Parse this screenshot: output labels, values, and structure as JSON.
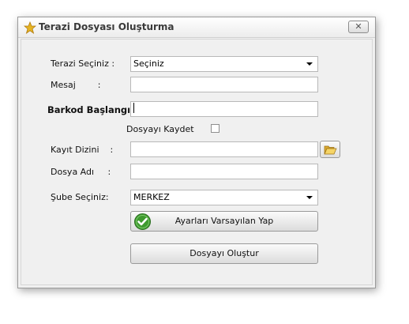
{
  "window": {
    "title": "Terazi Dosyası Oluşturma",
    "close_glyph": "✕"
  },
  "form": {
    "scale_label": "Terazi Seçiniz :",
    "scale_value": "Seçiniz",
    "message_label": "Mesaj        :",
    "message_value": "",
    "barcode_label": "Barkod Başlangıç :",
    "barcode_value": "",
    "save_file_label": "Dosyayı Kaydet",
    "save_file_checked": false,
    "folder_label": "Kayıt Dizini    :",
    "folder_value": "",
    "filename_label": "Dosya Adı     :",
    "filename_value": "",
    "branch_label": "Şube Seçiniz:",
    "branch_value": "MERKEZ"
  },
  "buttons": {
    "defaults_label": "Ayarları Varsayılan Yap",
    "create_label": "Dosyayı Oluştur"
  },
  "colors": {
    "accent_green": "#3e9a2f",
    "folder_yellow": "#e8c14a"
  }
}
